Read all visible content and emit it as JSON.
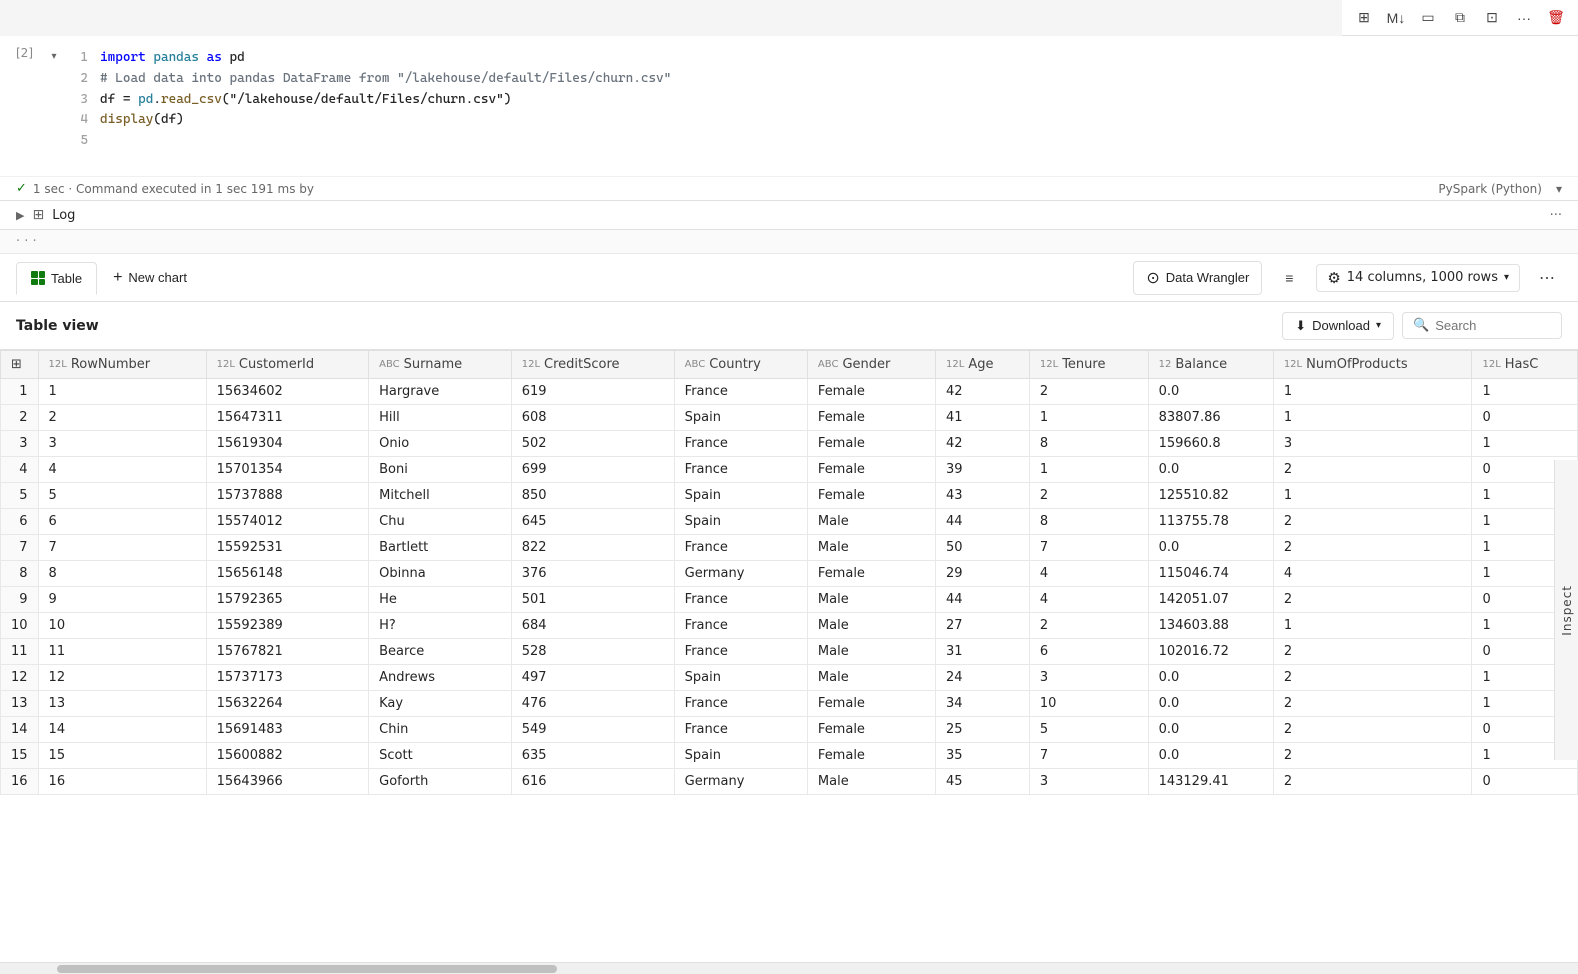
{
  "toolbar": {
    "buttons": [
      "panel-icon",
      "markdown-icon",
      "monitor-icon",
      "copy-icon",
      "split-icon",
      "more-icon",
      "trash-icon"
    ]
  },
  "cell": {
    "number": "[2]",
    "status_check": "✓",
    "status_text": "1 sec · Command executed in 1 sec 191 ms by",
    "runtime": "PySpark (Python)",
    "code_lines": [
      {
        "num": "1",
        "content": "import_pandas"
      },
      {
        "num": "2",
        "content": "comment"
      },
      {
        "num": "3",
        "content": "read_csv"
      },
      {
        "num": "4",
        "content": "display"
      },
      {
        "num": "5",
        "content": ""
      }
    ]
  },
  "log": {
    "label": "Log",
    "dots": "···"
  },
  "ellipsis": "· · ·",
  "tabs": {
    "table_label": "Table",
    "new_chart_label": "New chart"
  },
  "data_wrangler": {
    "label": "Data Wrangler"
  },
  "columns_info": {
    "label": "14 columns, 1000 rows"
  },
  "table_view": {
    "label": "Table view",
    "download_label": "Download",
    "search_placeholder": "Search"
  },
  "columns": [
    {
      "name": "RowNumber",
      "type": "12L"
    },
    {
      "name": "CustomerId",
      "type": "12L"
    },
    {
      "name": "Surname",
      "type": "ABC"
    },
    {
      "name": "CreditScore",
      "type": "12L"
    },
    {
      "name": "Country",
      "type": "ABC"
    },
    {
      "name": "Gender",
      "type": "ABC"
    },
    {
      "name": "Age",
      "type": "12L"
    },
    {
      "name": "Tenure",
      "type": "12L"
    },
    {
      "name": "Balance",
      "type": "12"
    },
    {
      "name": "NumOfProducts",
      "type": "12L"
    },
    {
      "name": "HasC",
      "type": "12L"
    }
  ],
  "rows": [
    [
      1,
      1,
      "15634602",
      "Hargrave",
      "619",
      "France",
      "Female",
      "42",
      "2",
      "0.0",
      "1",
      "1"
    ],
    [
      2,
      2,
      "15647311",
      "Hill",
      "608",
      "Spain",
      "Female",
      "41",
      "1",
      "83807.86",
      "1",
      "0"
    ],
    [
      3,
      3,
      "15619304",
      "Onio",
      "502",
      "France",
      "Female",
      "42",
      "8",
      "159660.8",
      "3",
      "1"
    ],
    [
      4,
      4,
      "15701354",
      "Boni",
      "699",
      "France",
      "Female",
      "39",
      "1",
      "0.0",
      "2",
      "0"
    ],
    [
      5,
      5,
      "15737888",
      "Mitchell",
      "850",
      "Spain",
      "Female",
      "43",
      "2",
      "125510.82",
      "1",
      "1"
    ],
    [
      6,
      6,
      "15574012",
      "Chu",
      "645",
      "Spain",
      "Male",
      "44",
      "8",
      "113755.78",
      "2",
      "1"
    ],
    [
      7,
      7,
      "15592531",
      "Bartlett",
      "822",
      "France",
      "Male",
      "50",
      "7",
      "0.0",
      "2",
      "1"
    ],
    [
      8,
      8,
      "15656148",
      "Obinna",
      "376",
      "Germany",
      "Female",
      "29",
      "4",
      "115046.74",
      "4",
      "1"
    ],
    [
      9,
      9,
      "15792365",
      "He",
      "501",
      "France",
      "Male",
      "44",
      "4",
      "142051.07",
      "2",
      "0"
    ],
    [
      10,
      10,
      "15592389",
      "H?",
      "684",
      "France",
      "Male",
      "27",
      "2",
      "134603.88",
      "1",
      "1"
    ],
    [
      11,
      11,
      "15767821",
      "Bearce",
      "528",
      "France",
      "Male",
      "31",
      "6",
      "102016.72",
      "2",
      "0"
    ],
    [
      12,
      12,
      "15737173",
      "Andrews",
      "497",
      "Spain",
      "Male",
      "24",
      "3",
      "0.0",
      "2",
      "1"
    ],
    [
      13,
      13,
      "15632264",
      "Kay",
      "476",
      "France",
      "Female",
      "34",
      "10",
      "0.0",
      "2",
      "1"
    ],
    [
      14,
      14,
      "15691483",
      "Chin",
      "549",
      "France",
      "Female",
      "25",
      "5",
      "0.0",
      "2",
      "0"
    ],
    [
      15,
      15,
      "15600882",
      "Scott",
      "635",
      "Spain",
      "Female",
      "35",
      "7",
      "0.0",
      "2",
      "1"
    ],
    [
      16,
      16,
      "15643966",
      "Goforth",
      "616",
      "Germany",
      "Male",
      "45",
      "3",
      "143129.41",
      "2",
      "0"
    ]
  ]
}
